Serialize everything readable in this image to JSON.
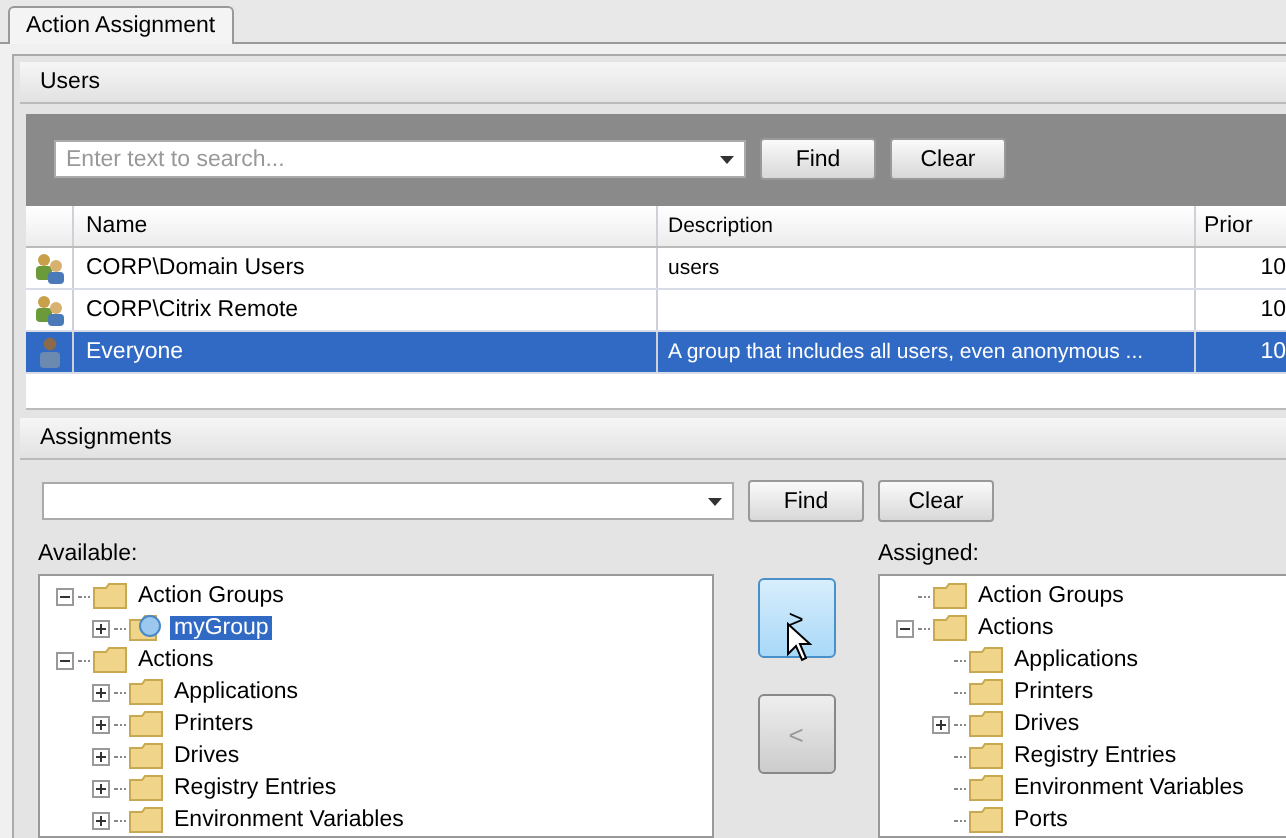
{
  "tabs": [
    {
      "label": "Action Assignment",
      "selected": true
    }
  ],
  "users": {
    "title": "Users",
    "search": {
      "placeholder": "Enter text to search..."
    },
    "find_button": "Find",
    "clear_button": "Clear",
    "columns": [
      "Name",
      "Description",
      "Prior"
    ],
    "rows": [
      {
        "kind": "group",
        "name": "CORP\\Domain Users",
        "description": "users",
        "priority": "10",
        "selected": false
      },
      {
        "kind": "group",
        "name": "CORP\\Citrix Remote",
        "description": "",
        "priority": "10",
        "selected": false
      },
      {
        "kind": "user",
        "name": "Everyone",
        "description": "A group that includes all users, even anonymous ...",
        "priority": "10",
        "selected": true
      }
    ]
  },
  "assignments": {
    "title": "Assignments",
    "find_button": "Find",
    "clear_button": "Clear",
    "available_label": "Available:",
    "assigned_label": "Assigned:",
    "add_button": {
      "label": ">",
      "disabled": false,
      "hovered": true
    },
    "remove_button": {
      "label": "<",
      "disabled": true,
      "hovered": false
    },
    "available": [
      {
        "label": "Action Groups",
        "kind": "folder",
        "expanded": true,
        "selected": false,
        "children": [
          {
            "label": "myGroup",
            "kind": "group",
            "expanded": false,
            "selected": true
          }
        ]
      },
      {
        "label": "Actions",
        "kind": "folder",
        "expanded": true,
        "selected": false,
        "children": [
          {
            "label": "Applications",
            "kind": "folder",
            "expanded": false,
            "selected": false
          },
          {
            "label": "Printers",
            "kind": "folder",
            "expanded": false,
            "selected": false
          },
          {
            "label": "Drives",
            "kind": "folder",
            "expanded": false,
            "selected": false
          },
          {
            "label": "Registry Entries",
            "kind": "folder",
            "expanded": false,
            "selected": false
          },
          {
            "label": "Environment Variables",
            "kind": "folder",
            "expanded": false,
            "selected": false
          }
        ]
      }
    ],
    "assigned": [
      {
        "label": "Action Groups",
        "kind": "folder",
        "selected": false
      },
      {
        "label": "Actions",
        "kind": "folder",
        "expanded": true,
        "selected": false,
        "children": [
          {
            "label": "Applications",
            "kind": "folder",
            "selected": false
          },
          {
            "label": "Printers",
            "kind": "folder",
            "selected": false
          },
          {
            "label": "Drives",
            "kind": "folder",
            "expanded": false,
            "selected": false
          },
          {
            "label": "Registry Entries",
            "kind": "folder",
            "selected": false
          },
          {
            "label": "Environment Variables",
            "kind": "folder",
            "selected": false
          },
          {
            "label": "Ports",
            "kind": "folder",
            "selected": false
          }
        ]
      }
    ]
  }
}
